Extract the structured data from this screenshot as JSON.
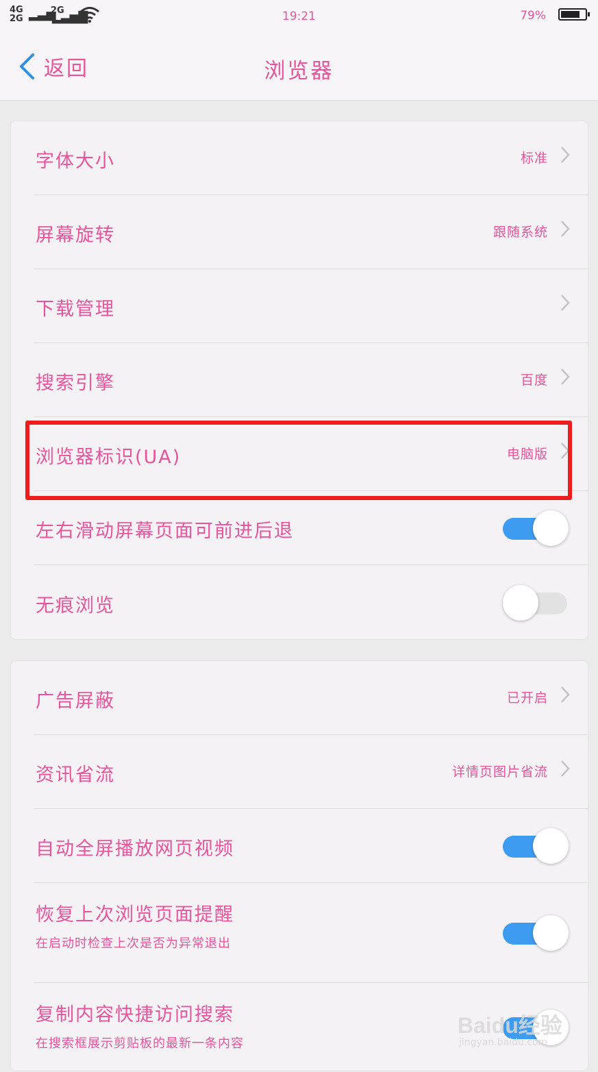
{
  "status_bar": {
    "network_primary": "4G",
    "network_secondary": "2G",
    "network_tertiary": "2G",
    "time": "19:21",
    "battery_text": "79%",
    "battery_level": 0.79,
    "wifi_icon": "wifi-icon"
  },
  "nav": {
    "back_label": "返回",
    "title": "浏览器"
  },
  "settings_group_1": [
    {
      "label": "字体大小",
      "value": "标准",
      "control": "chevron"
    },
    {
      "label": "屏幕旋转",
      "value": "跟随系统",
      "control": "chevron"
    },
    {
      "label": "下载管理",
      "value": "",
      "control": "chevron"
    },
    {
      "label": "搜索引擎",
      "value": "百度",
      "control": "chevron"
    },
    {
      "label": "浏览器标识(UA)",
      "value": "电脑版",
      "control": "chevron"
    },
    {
      "label": "左右滑动屏幕页面可前进后退",
      "control": "toggle",
      "on": true
    },
    {
      "label": "无痕浏览",
      "control": "toggle",
      "on": false
    }
  ],
  "settings_group_2": [
    {
      "label": "广告屏蔽",
      "value": "已开启",
      "control": "chevron"
    },
    {
      "label": "资讯省流",
      "value": "详情页图片省流",
      "control": "chevron"
    },
    {
      "label": "自动全屏播放网页视频",
      "control": "toggle",
      "on": true
    },
    {
      "label": "恢复上次浏览页面提醒",
      "sub": "在启动时检查上次是否为异常退出",
      "control": "toggle",
      "on": true
    },
    {
      "label": "复制内容快捷访问搜索",
      "sub": "在搜索框展示剪贴板的最新一条内容",
      "control": "toggle",
      "on": true
    }
  ],
  "watermark": {
    "brand": "Baidu经验",
    "url": "jingyan.baidu.com"
  },
  "colors": {
    "text_pink": "#e8549b",
    "toggle_on": "#3d9cf0",
    "back_arrow": "#2f8fe0",
    "highlight_red": "#ee1c1c"
  }
}
